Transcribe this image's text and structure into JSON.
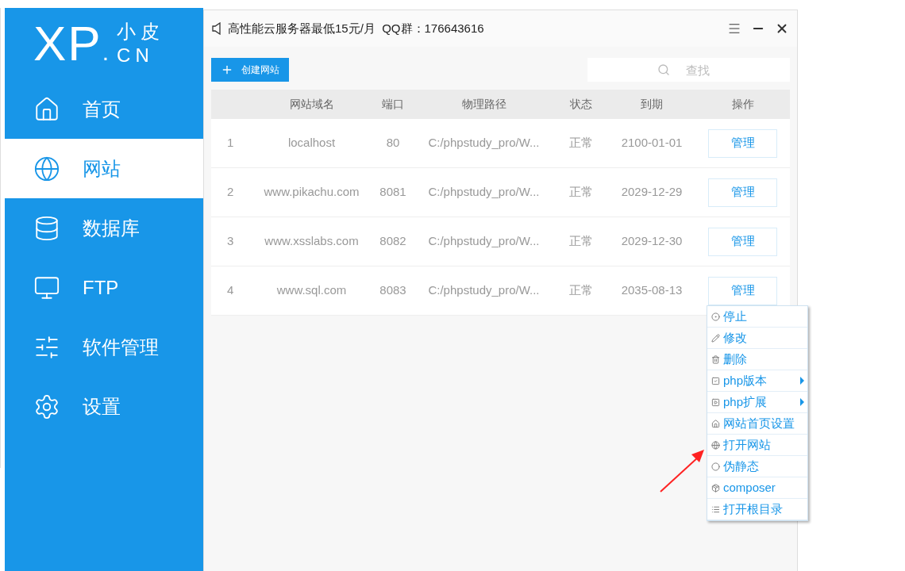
{
  "logo": {
    "mark": "XP",
    "dot": ".",
    "name_top": "小皮",
    "name_bottom": "CN"
  },
  "sidebar": {
    "items": [
      {
        "label": "首页",
        "selected": false
      },
      {
        "label": "网站",
        "selected": true
      },
      {
        "label": "数据库",
        "selected": false
      },
      {
        "label": "FTP",
        "selected": false
      },
      {
        "label": "软件管理",
        "selected": false
      },
      {
        "label": "设置",
        "selected": false
      }
    ]
  },
  "window": {
    "title": "高性能云服务器最低15元/月  QQ群：176643616"
  },
  "toolbar": {
    "create_button": "创建网站",
    "search": {
      "placeholder": "查找"
    }
  },
  "table": {
    "columns": [
      "",
      "网站域名",
      "端口",
      "物理路径",
      "状态",
      "到期",
      "操作"
    ],
    "rows": [
      {
        "cells": [
          "1",
          "localhost",
          "80",
          "C:/phpstudy_pro/W...",
          "正常",
          "2100-01-01"
        ],
        "action": "管理"
      },
      {
        "cells": [
          "2",
          "www.pikachu.com",
          "8081",
          "C:/phpstudy_pro/W...",
          "正常",
          "2029-12-29"
        ],
        "action": "管理"
      },
      {
        "cells": [
          "3",
          "www.xsslabs.com",
          "8082",
          "C:/phpstudy_pro/W...",
          "正常",
          "2029-12-30"
        ],
        "action": "管理"
      },
      {
        "cells": [
          "4",
          "www.sql.com",
          "8083",
          "C:/phpstudy_pro/W...",
          "正常",
          "2035-08-13"
        ],
        "action": "管理"
      }
    ]
  },
  "context_menu": {
    "items": [
      {
        "label": "停止",
        "submenu": false
      },
      {
        "label": "修改",
        "submenu": false
      },
      {
        "label": "删除",
        "submenu": false
      },
      {
        "label": "php版本",
        "submenu": true
      },
      {
        "label": "php扩展",
        "submenu": true
      },
      {
        "label": "网站首页设置",
        "submenu": false
      },
      {
        "label": "打开网站",
        "submenu": false
      },
      {
        "label": "伪静态",
        "submenu": false
      },
      {
        "label": "composer",
        "submenu": false
      },
      {
        "label": "打开根目录",
        "submenu": false
      }
    ]
  }
}
